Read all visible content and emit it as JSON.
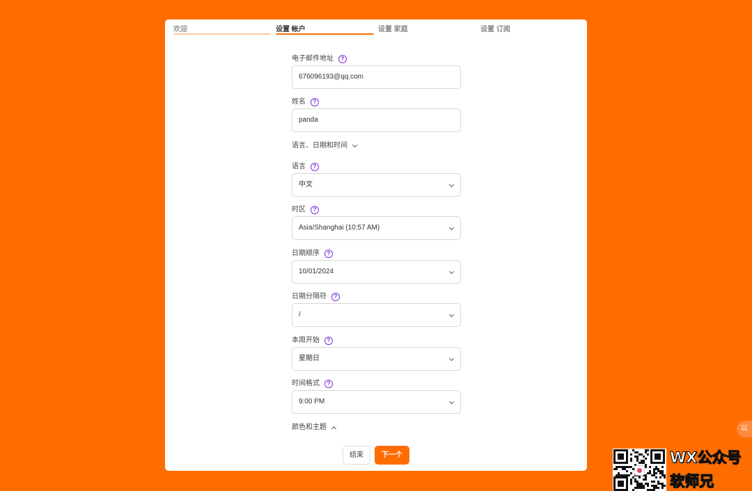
{
  "steps": [
    {
      "label": "欢迎",
      "state": "done"
    },
    {
      "label": "设置 帐户",
      "state": "active"
    },
    {
      "label": "设置 家庭",
      "state": "pending"
    },
    {
      "label": "设置 订阅",
      "state": "pending"
    }
  ],
  "form": {
    "email": {
      "label": "电子邮件地址",
      "value": "676096193@qq.com"
    },
    "name": {
      "label": "姓名",
      "value": "panda"
    },
    "section_locale": {
      "label": "语言、日期和时间",
      "expanded": true
    },
    "language": {
      "label": "语言",
      "value": "中文"
    },
    "timezone": {
      "label": "时区",
      "value": "Asia/Shanghai (10:57 AM)"
    },
    "date_order": {
      "label": "日期顺序",
      "value": "10/01/2024"
    },
    "date_separator": {
      "label": "日期分隔符",
      "value": "/"
    },
    "week_start": {
      "label": "本周开始",
      "value": "星期日"
    },
    "time_format": {
      "label": "时间格式",
      "value": "9:00 PM"
    },
    "section_theme": {
      "label": "颜色和主题",
      "expanded": false
    }
  },
  "buttons": {
    "finish": "结束",
    "next": "下一个"
  },
  "side_float": {
    "label": "以"
  },
  "watermark": {
    "line1": "WX公众号",
    "line2": "软师兄"
  },
  "colors": {
    "accent": "#ff6d00",
    "help_icon": "#7a2fd8",
    "background": "#ff6d00"
  },
  "icons": {
    "help": "question-circle-icon",
    "select": "chevron-down-icon",
    "collapse": "chevron-up-icon"
  }
}
